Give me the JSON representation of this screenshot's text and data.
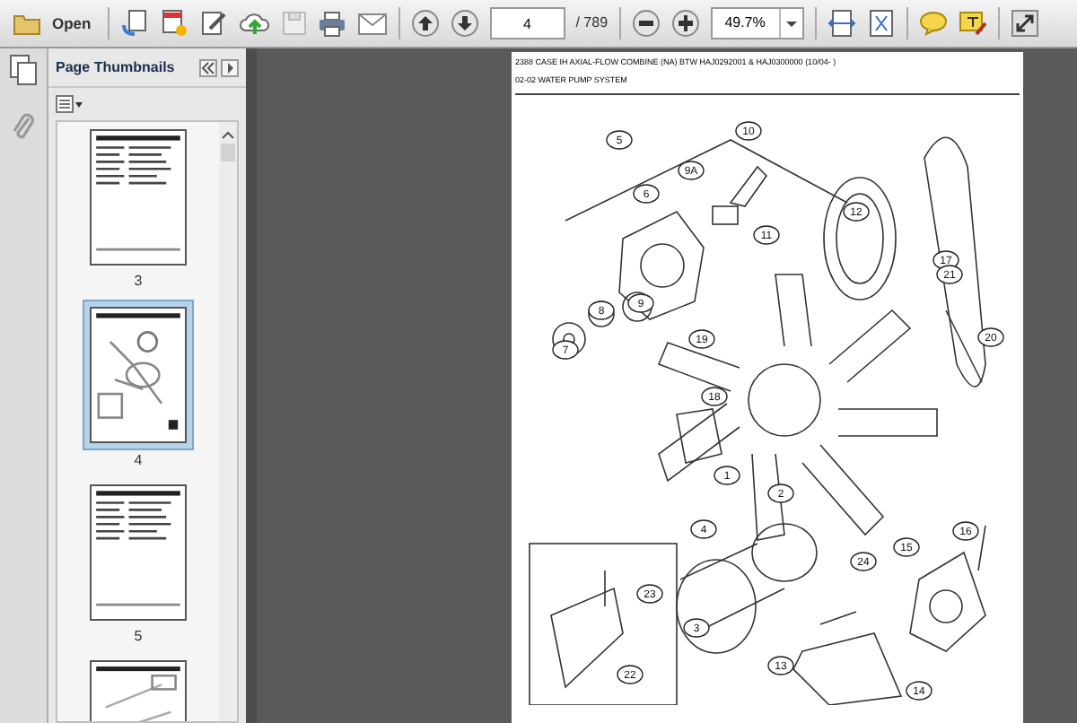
{
  "toolbar": {
    "open_label": "Open",
    "page_number": "4",
    "page_total": "/ 789",
    "zoom": "49.7%"
  },
  "sidebar": {
    "title": "Page Thumbnails",
    "thumbnails": [
      {
        "label": "3",
        "selected": false,
        "kind": "table"
      },
      {
        "label": "4",
        "selected": true,
        "kind": "diagram"
      },
      {
        "label": "5",
        "selected": false,
        "kind": "table"
      },
      {
        "selected": false,
        "kind": "sketch"
      }
    ]
  },
  "document": {
    "header": "2388 CASE IH AXIAL-FLOW COMBINE (NA) BTW HAJ0292001 & HAJ0300000 (10/04- )",
    "section": "02-02 WATER PUMP SYSTEM",
    "callouts": [
      "5",
      "10",
      "6",
      "9A",
      "12",
      "17",
      "11",
      "8",
      "7",
      "9",
      "21",
      "20",
      "19",
      "18",
      "1",
      "2",
      "4",
      "24",
      "3",
      "23",
      "22",
      "15",
      "16",
      "13",
      "14"
    ]
  }
}
